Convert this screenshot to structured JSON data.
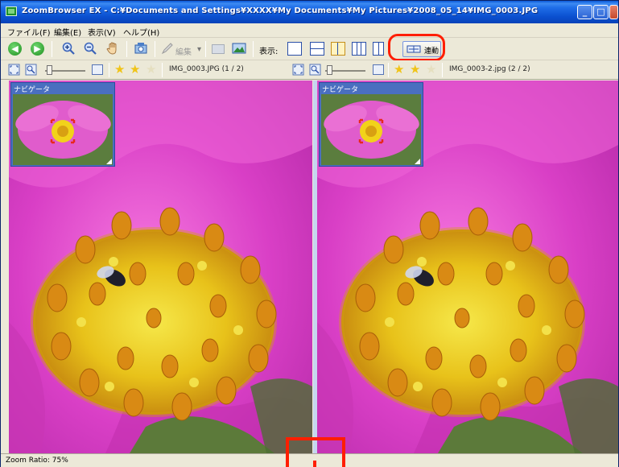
{
  "window": {
    "title": "ZoomBrowser EX - C:¥Documents and Settings¥XXXX¥My Documents¥My Pictures¥2008_05_14¥IMG_0003.JPG",
    "controls": {
      "minimize": "_",
      "maximize": "□",
      "close": "×"
    }
  },
  "menu": [
    "ファイル(F)",
    "編集(E)",
    "表示(V)",
    "ヘルプ(H)"
  ],
  "toolbar": {
    "back": "◀",
    "forward": "▶",
    "edit_label": "編集",
    "view_label": "表示:",
    "link_label": "連動"
  },
  "left_pane": {
    "file_label": "IMG_0003.JPG (1 / 2)",
    "navigator_title": "ナビゲータ",
    "rating": 2
  },
  "right_pane": {
    "file_label": "IMG_0003-2.jpg (2 / 2)",
    "navigator_title": "ナビゲータ",
    "rating": 2
  },
  "status": {
    "zoom_ratio": "Zoom Ratio: 75%"
  },
  "colors": {
    "titlebar": "#0b50d0",
    "highlight": "#ff1e00",
    "petal": "#e040c8",
    "center": "#f2d21a"
  },
  "icons": [
    "back-icon",
    "forward-icon",
    "zoom-in-icon",
    "zoom-out-icon",
    "hand-icon",
    "rotate-icon",
    "edit-icon",
    "view-single-icon",
    "view-split-horizontal-icon",
    "view-split-vertical-icon",
    "view-grid-icon",
    "link-icon",
    "fit-icon",
    "actual-size-icon",
    "star-icon"
  ]
}
